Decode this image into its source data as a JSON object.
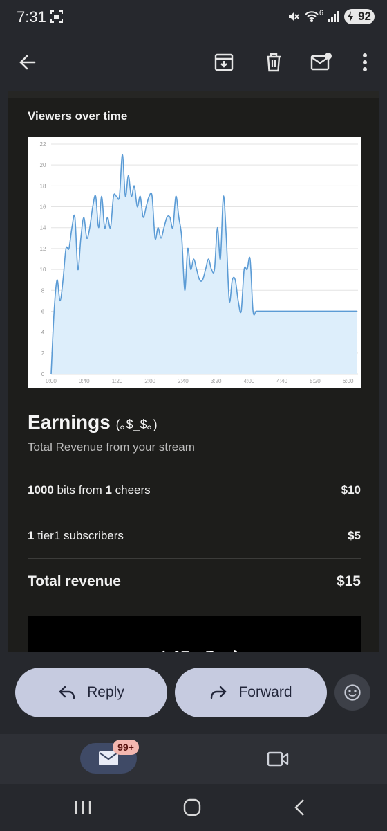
{
  "status": {
    "time": "7:31",
    "battery": "92",
    "signal_label": "6"
  },
  "toolbar": {
    "back": "back",
    "archive": "archive",
    "delete": "delete",
    "mark_unread": "mark unread",
    "more": "more options"
  },
  "email": {
    "chart_title": "Viewers over time",
    "earnings_title": "Earnings",
    "earnings_kaomoji": "(｡$_$｡)",
    "earnings_subtitle": "Total Revenue from your stream",
    "rows": [
      {
        "pre": "1000",
        "mid": " bits from ",
        "num": "1",
        "post": " cheers",
        "amount": "$10"
      },
      {
        "pre": "1",
        "mid": " tier1 subscribers",
        "num": "",
        "post": "",
        "amount": "$5"
      }
    ],
    "total_label": "Total revenue",
    "total_amount": "$15",
    "bottom_kaomoji": "ヾ( ̄▽ ̄)ノ"
  },
  "actions": {
    "reply_label": "Reply",
    "forward_label": "Forward"
  },
  "nav": {
    "mail_badge": "99+"
  },
  "chart_data": {
    "type": "line",
    "title": "",
    "xlabel": "",
    "ylabel": "",
    "ylim": [
      0,
      22
    ],
    "yticks": [
      0,
      2,
      4,
      6,
      8,
      10,
      12,
      14,
      16,
      18,
      20,
      22
    ],
    "xlim": [
      0,
      6.2
    ],
    "xtick_values": [
      0,
      0.6667,
      1.3333,
      2,
      2.6667,
      3.3333,
      4,
      4.6667,
      5.3333,
      6
    ],
    "xtick_labels": [
      "0:00",
      "0:40",
      "1:20",
      "2:00",
      "2:40",
      "3:20",
      "4:00",
      "4:40",
      "5:20",
      "6:00"
    ],
    "grid": true,
    "line_color": "#5b9bd5",
    "fill_color": "#ddeefb",
    "series": [
      {
        "x": [
          0,
          0.06,
          0.12,
          0.18,
          0.24,
          0.3,
          0.36,
          0.42,
          0.48,
          0.54,
          0.6,
          0.66,
          0.72,
          0.78,
          0.84,
          0.9,
          0.96,
          1.02,
          1.08,
          1.14,
          1.2,
          1.26,
          1.32,
          1.38,
          1.44,
          1.5,
          1.56,
          1.62,
          1.68,
          1.74,
          1.8,
          1.86,
          1.92,
          1.98,
          2.04,
          2.1,
          2.16,
          2.22,
          2.28,
          2.34,
          2.4,
          2.46,
          2.52,
          2.58,
          2.64,
          2.7,
          2.76,
          2.82,
          2.88,
          2.94,
          3.0,
          3.06,
          3.12,
          3.18,
          3.24,
          3.3,
          3.36,
          3.42,
          3.48,
          3.54,
          3.6,
          3.66,
          3.72,
          3.78,
          3.84,
          3.9,
          3.96,
          4.02,
          4.08,
          4.14,
          4.2,
          4.26,
          4.32,
          4.38,
          4.44,
          4.5,
          4.56,
          4.62,
          4.68,
          4.74,
          4.8,
          4.86,
          4.92,
          4.98,
          5.04,
          5.1,
          5.16,
          5.22,
          5.28,
          5.34,
          5.4,
          5.46,
          5.52,
          5.58,
          5.64,
          5.7,
          5.76,
          5.82,
          5.88,
          5.94,
          6.0,
          6.06,
          6.12,
          6.18
        ],
        "y": [
          0,
          6,
          9,
          7,
          9,
          12,
          12,
          14,
          15,
          10,
          13,
          15,
          13,
          14,
          16,
          17,
          14,
          17,
          14,
          15,
          14,
          17,
          17,
          17,
          21,
          17,
          19,
          17,
          18,
          16,
          17,
          15,
          16,
          17,
          17,
          13,
          14,
          13,
          14,
          15,
          15,
          14,
          17,
          15,
          13,
          8,
          12,
          10,
          11,
          10,
          9,
          9,
          10,
          11,
          10,
          10,
          14,
          11,
          17,
          13,
          7,
          9,
          9,
          7,
          6,
          10,
          10,
          11,
          6,
          6,
          6,
          6,
          6,
          6,
          6,
          6,
          6,
          6,
          6,
          6,
          6,
          6,
          6,
          6,
          6,
          6,
          6,
          6,
          6,
          6,
          6,
          6,
          6,
          6,
          6,
          6,
          6,
          6,
          6,
          6,
          6,
          6,
          6,
          6
        ]
      }
    ]
  }
}
